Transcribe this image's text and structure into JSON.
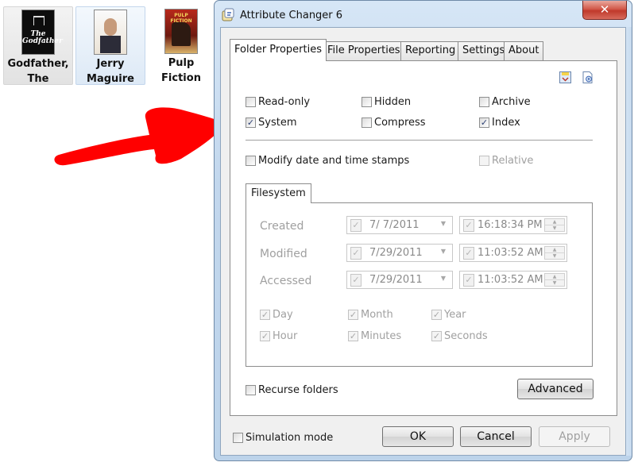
{
  "desktop": {
    "files": [
      {
        "label_line1": "Godfather,",
        "label_line2": "The"
      },
      {
        "label_line1": "Jerry",
        "label_line2": "Maguire"
      },
      {
        "label_line1": "Pulp",
        "label_line2": "Fiction"
      }
    ],
    "poster_godfather_text": "The Godfather",
    "poster_pulp_text": "PULP FICTION"
  },
  "window": {
    "title": "Attribute Changer 6",
    "close_label": "✕"
  },
  "tabs": [
    "Folder Properties",
    "File Properties",
    "Reporting",
    "Settings",
    "About"
  ],
  "attributes": {
    "read_only": {
      "label": "Read-only",
      "checked": false
    },
    "hidden": {
      "label": "Hidden",
      "checked": false
    },
    "archive": {
      "label": "Archive",
      "checked": false
    },
    "system": {
      "label": "System",
      "checked": true
    },
    "compress": {
      "label": "Compress",
      "checked": false
    },
    "index": {
      "label": "Index",
      "checked": true
    }
  },
  "timestamps": {
    "modify_label": "Modify date and time stamps",
    "relative_label": "Relative"
  },
  "filesystem": {
    "tab_label": "Filesystem",
    "rows": [
      {
        "label": "Created",
        "date": "7/  7/2011",
        "time": "16:18:34 PM"
      },
      {
        "label": "Modified",
        "date": "7/29/2011",
        "time": "11:03:52 AM"
      },
      {
        "label": "Accessed",
        "date": "7/29/2011",
        "time": "11:03:52 AM"
      }
    ],
    "parts": {
      "day": "Day",
      "month": "Month",
      "year": "Year",
      "hour": "Hour",
      "minutes": "Minutes",
      "seconds": "Seconds"
    }
  },
  "options": {
    "recurse_label": "Recurse folders",
    "advanced_label": "Advanced",
    "simulation_label": "Simulation mode"
  },
  "buttons": {
    "ok": "OK",
    "cancel": "Cancel",
    "apply": "Apply"
  },
  "glyphs": {
    "check": "✓",
    "dropdown": "▼",
    "spin_up": "▲",
    "spin_down": "▼"
  },
  "colors": {
    "annotation_arrow": "#ff0000",
    "window_frame": "#c2d7ed",
    "close_button": "#c0392b"
  }
}
